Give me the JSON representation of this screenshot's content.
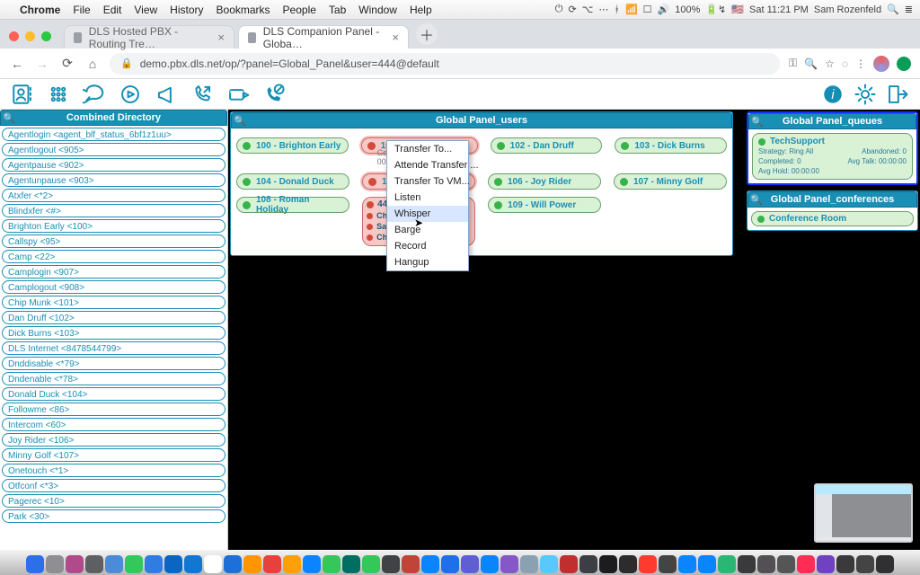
{
  "menubar": {
    "items": [
      "Chrome",
      "File",
      "Edit",
      "View",
      "History",
      "Bookmarks",
      "People",
      "Tab",
      "Window",
      "Help"
    ],
    "battery": "100%",
    "clock": "Sat 11:21 PM",
    "user": "Sam Rozenfeld"
  },
  "tabs": {
    "inactive": "DLS Hosted PBX - Routing Tre…",
    "active": "DLS Companion Panel - Globa…"
  },
  "url": "demo.pbx.dls.net/op/?panel=Global_Panel&user=444@default",
  "directory": {
    "title": "Combined Directory",
    "items": [
      "Agentlogin <agent_blf_status_6bf1z1uu>",
      "Agentlogout <905>",
      "Agentpause <902>",
      "Agentunpause <903>",
      "Atxfer <*2>",
      "Blindxfer <#>",
      "Brighton Early <100>",
      "Callspy <95>",
      "Camp <22>",
      "Camplogin <907>",
      "Camplogout <908>",
      "Chip Munk <101>",
      "Dan Druff <102>",
      "Dick Burns <103>",
      "DLS Internet <8478544799>",
      "Dnddisable <*79>",
      "Dndenable <*78>",
      "Donald Duck <104>",
      "Followme <86>",
      "Intercom <60>",
      "Joy Rider <106>",
      "Minny Golf <107>",
      "Onetouch <*1>",
      "Otfconf <*3>",
      "Pagerec <10>",
      "Park <30>"
    ]
  },
  "users": {
    "title": "Global Panel_users",
    "active_ext": {
      "label": "101 - Chip Munk",
      "sub": "Cell Phone IL . #4 … 00:00:30"
    },
    "stack": {
      "ext": "444",
      "l1": "Chi…",
      "l2": "Sam…",
      "l3": "Chi…"
    },
    "rows": [
      [
        "100 - Brighton Early",
        null,
        "102 - Dan Druff",
        "103 - Dick Burns"
      ],
      [
        "104 - Donald Duck",
        "105",
        "106 - Joy Rider",
        "107 - Minny Golf"
      ],
      [
        "108 - Roman Holiday",
        null,
        "109 - Will Power",
        null
      ]
    ]
  },
  "context_menu": {
    "items": [
      "Transfer To...",
      "Attende Transfer ...",
      "Transfer To VM...",
      "Listen",
      "Whisper",
      "Barge",
      "Record",
      "Hangup"
    ],
    "highlighted": "Whisper"
  },
  "queues": {
    "title": "Global Panel_queues",
    "item": {
      "name": "TechSupport",
      "left": [
        "Strategy: Ring All",
        "Completed: 0",
        "Avg Hold: 00:00:00"
      ],
      "right": [
        "Abandoned: 0",
        "Avg Talk: 00:00:00"
      ]
    }
  },
  "conferences": {
    "title": "Global Panel_conferences",
    "item": "Conference Room"
  },
  "dock_colors": [
    "#2b6fea",
    "#8e8e93",
    "#b04a8a",
    "#5d5f63",
    "#4b8bd8",
    "#34c759",
    "#2f7de1",
    "#0b66c2",
    "#1177d1",
    "#ffffff",
    "#1e6fd8",
    "#ff9500",
    "#e6413c",
    "#ff9f0a",
    "#0a84ff",
    "#34c759",
    "#006f62",
    "#34c759",
    "#414246",
    "#c14438",
    "#0a84ff",
    "#1f6feb",
    "#5f5fd3",
    "#0a84ff",
    "#8557c7",
    "#8aa1b1",
    "#5ac8fa",
    "#c02f2f",
    "#3b3e45",
    "#1c1c1e",
    "#2c2c2e",
    "#ff3b30",
    "#444",
    "#0a84ff",
    "#0a84ff",
    "#2bb673",
    "#3a3a3c",
    "#524f55",
    "#555",
    "#ff2d55",
    "#6f42c1",
    "#3a3a3c",
    "#444",
    "#303033"
  ]
}
